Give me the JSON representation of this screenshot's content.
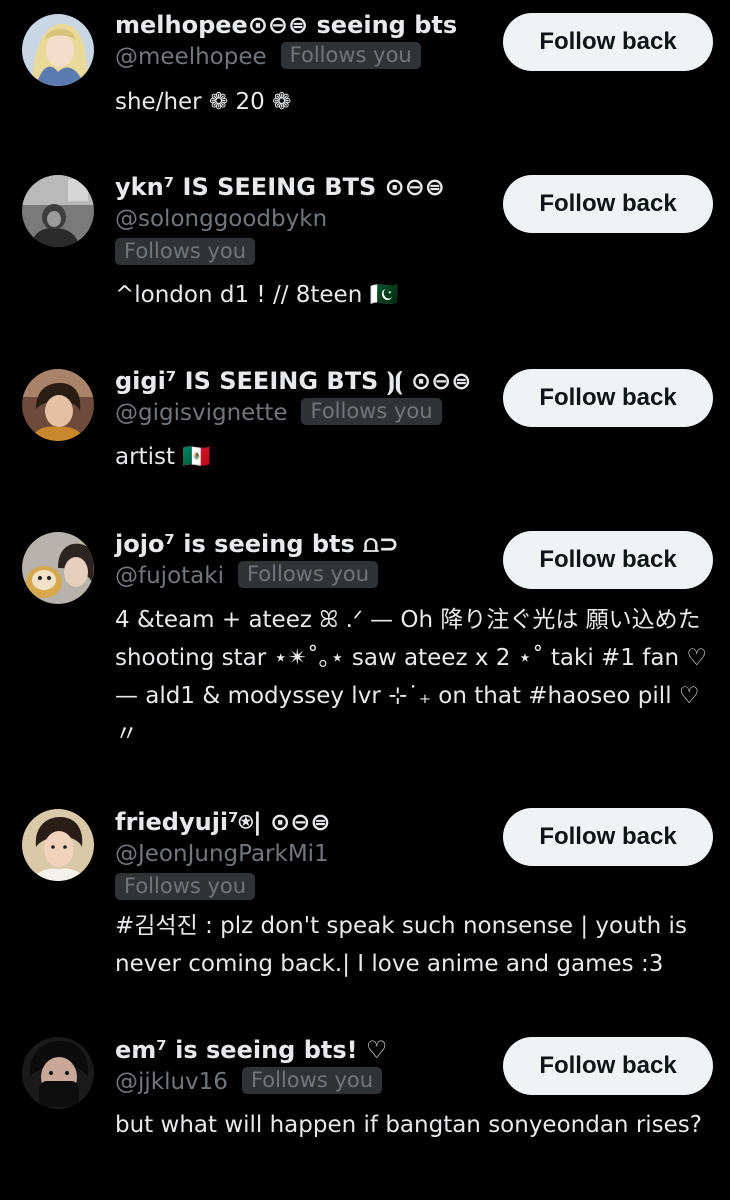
{
  "users": [
    {
      "avatar": "avatar-anime-illustration",
      "name": "melhopee⊙⊖⊜ seeing bts",
      "handle": "@meelhopee",
      "follows_you": "Follows you",
      "bio": "she/her ❁ 20 ❁",
      "button": "Follow back"
    },
    {
      "avatar": "avatar-photo",
      "name": "ykn⁷ IS SEEING BTS ⊙⊖⊜",
      "handle": "@solonggoodbykn",
      "follows_you": "Follows you",
      "bio": "^london d1 ! // 8teen 🇵🇰",
      "button": "Follow back"
    },
    {
      "avatar": "avatar-photo",
      "name": "gigi⁷ IS SEEING BTS ⦘⦗ ⊙⊖⊜",
      "handle": "@gigisvignette",
      "follows_you": "Follows you",
      "bio": "artist 🇲🇽",
      "button": "Follow back"
    },
    {
      "avatar": "avatar-photo",
      "name": "jojo⁷ is seeing bts ⩍⊃",
      "handle": "@fujotaki",
      "follows_you": "Follows you",
      "bio": "4 &team + ateez ꕤ .ᐟ — Oh 降り注ぐ光は 願い込めた shooting star ⋆✴︎˚｡⋆ saw ateez x 2 ⋆˚ taki #1 fan ♡ — ald1 & modyssey lvr ⊹˙₊ on that #haoseo pill ♡〃",
      "button": "Follow back"
    },
    {
      "avatar": "avatar-photo",
      "name": "friedyuji⁷⍟| ⊙⊖⊜",
      "handle": "@JeonJungParkMi1",
      "follows_you": "Follows you",
      "bio": "#김석진 : plz don't speak such nonsense | youth is never coming back.| I love anime and games :3",
      "button": "Follow back"
    },
    {
      "avatar": "avatar-photo",
      "name": "em⁷ is seeing bts! ♡",
      "handle": "@jjkluv16",
      "follows_you": "Follows you",
      "bio": "but what will happen if bangtan sonyeondan rises?",
      "button": "Follow back"
    }
  ]
}
